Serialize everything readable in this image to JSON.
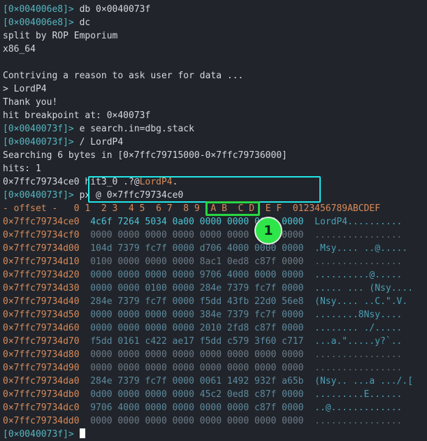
{
  "terminal": {
    "background": "#21252b",
    "foreground": "#d5d8de",
    "prompt_color": "#56b6c2",
    "accent_orange": "#d98a5a",
    "lines": [
      {
        "id": "l1",
        "prompt": "[0×004006e8]>",
        "text": " db 0×0040073f"
      },
      {
        "id": "l2",
        "prompt": "[0×004006e8]>",
        "text": " dc"
      },
      {
        "id": "l3",
        "prompt": "",
        "text": "split by ROP Emporium"
      },
      {
        "id": "l4",
        "prompt": "",
        "text": "x86_64"
      },
      {
        "id": "l5",
        "prompt": "",
        "text": ""
      },
      {
        "id": "l6",
        "prompt": "",
        "text": "Contriving a reason to ask user for data ..."
      },
      {
        "id": "l7",
        "prompt": "",
        "text": "> LordP4"
      },
      {
        "id": "l8",
        "prompt": "",
        "text": "Thank you!"
      },
      {
        "id": "l9",
        "prompt": "",
        "text": "hit breakpoint at: 0×40073f"
      },
      {
        "id": "l10",
        "prompt": "[0×0040073f]>",
        "text": " e search.in=dbg.stack"
      },
      {
        "id": "l11",
        "prompt": "[0×0040073f]>",
        "text": " / LordP4"
      },
      {
        "id": "l12",
        "prompt": "",
        "text": "Searching 6 bytes in [0×7ffc79715000-0×7ffc79736000]"
      },
      {
        "id": "l13",
        "prompt": "",
        "text": "hits: 1"
      },
      {
        "id": "l14",
        "prompt": "",
        "text": "0×7ffc79734ce0 hit3_0 .?@",
        "highlight": "LordP4",
        "tail": "."
      },
      {
        "id": "l15",
        "prompt": "[0×0040073f]>",
        "text": " px @ 0×7ffc79734ce0"
      }
    ],
    "final_prompt": "[0×0040073f]>",
    "cursor": "block"
  },
  "hexdump": {
    "header_offset_label": "- offset -",
    "header_columns": "0 1  2 3  4 5  6 7  8 9  A B  C D  E F",
    "header_ascii": "0123456789ABCDEF",
    "rows": [
      {
        "offset": "0×7ffc79734ce0",
        "hex": "4c6f 7264 5034 0a00 0000 0000 0000 0000",
        "ascii": "LordP4.........."
      },
      {
        "offset": "0×7ffc79734cf0",
        "hex": "0000 0000 0000 0000 0000 0000 0000 0000",
        "ascii": "................"
      },
      {
        "offset": "0×7ffc79734d00",
        "hex": "104d 7379 fc7f 0000 d706 4000 0000 0000",
        "ascii": ".Msy.... ..@....."
      },
      {
        "offset": "0×7ffc79734d10",
        "hex": "0100 0000 0000 0000 8ac1 0ed8 c87f 0000",
        "ascii": "................"
      },
      {
        "offset": "0×7ffc79734d20",
        "hex": "0000 0000 0000 0000 9706 4000 0000 0000",
        "ascii": "..........@....."
      },
      {
        "offset": "0×7ffc79734d30",
        "hex": "0000 0000 0100 0000 284e 7379 fc7f 0000",
        "ascii": "..... ... (Nsy...."
      },
      {
        "offset": "0×7ffc79734d40",
        "hex": "284e 7379 fc7f 0000 f5dd 43fb 22d0 56e8",
        "ascii": "(Nsy.... ..C.\".V."
      },
      {
        "offset": "0×7ffc79734d50",
        "hex": "0000 0000 0000 0000 384e 7379 fc7f 0000",
        "ascii": "........8Nsy...."
      },
      {
        "offset": "0×7ffc79734d60",
        "hex": "0000 0000 0000 0000 2010 2fd8 c87f 0000",
        "ascii": "........ ./....."
      },
      {
        "offset": "0×7ffc79734d70",
        "hex": "f5dd 0161 c422 ae17 f5dd c579 3f60 c717",
        "ascii": "...a.\".....y?`.."
      },
      {
        "offset": "0×7ffc79734d80",
        "hex": "0000 0000 0000 0000 0000 0000 0000 0000",
        "ascii": "................"
      },
      {
        "offset": "0×7ffc79734d90",
        "hex": "0000 0000 0000 0000 0000 0000 0000 0000",
        "ascii": "................"
      },
      {
        "offset": "0×7ffc79734da0",
        "hex": "284e 7379 fc7f 0000 0061 1492 932f a65b",
        "ascii": "(Nsy.. ...a .../.["
      },
      {
        "offset": "0×7ffc79734db0",
        "hex": "0d00 0000 0000 0000 45c2 0ed8 c87f 0000",
        "ascii": ".........E......"
      },
      {
        "offset": "0×7ffc79734dc0",
        "hex": "9706 4000 0000 0000 0000 0000 c87f 0000",
        "ascii": "..@............."
      },
      {
        "offset": "0×7ffc79734dd0",
        "hex": "0000 0000 0000 0000 0000 0000 0000 0000",
        "ascii": "................"
      }
    ]
  },
  "annotations": {
    "cyan_box": {
      "color": "#21e6e6",
      "label": "search-result-highlight"
    },
    "green_box": {
      "color": "#28d643",
      "label": "return-address-highlight"
    },
    "badge": {
      "number": "1",
      "color": "#2ee64a"
    }
  }
}
